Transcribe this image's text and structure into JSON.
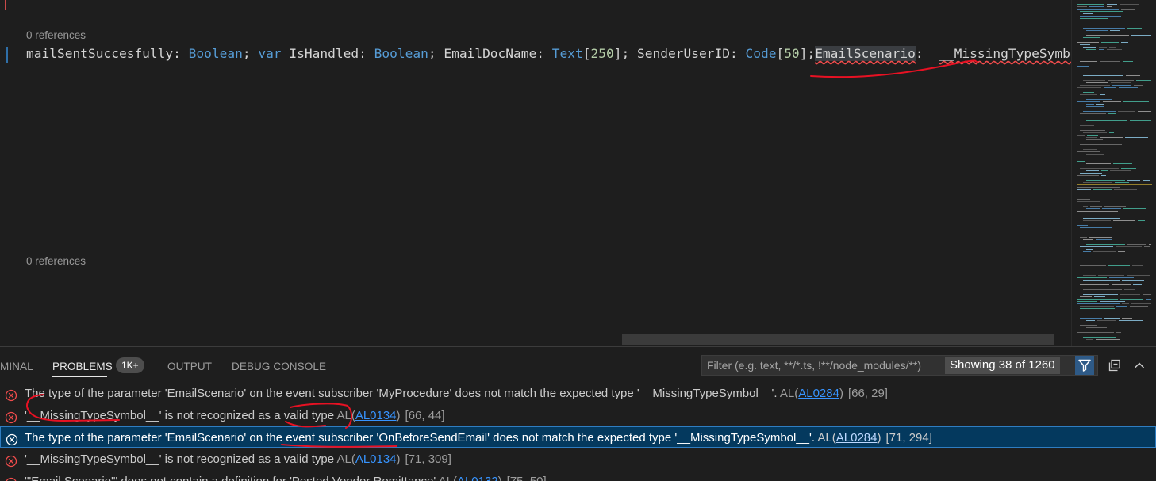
{
  "editor": {
    "codelens_top": "0 references",
    "codelens_bottom": "0 references",
    "code_segments": [
      {
        "text": "mailSentSuccesfully: ",
        "cls": ""
      },
      {
        "text": "Boolean",
        "cls": "tk-kw"
      },
      {
        "text": "; ",
        "cls": ""
      },
      {
        "text": "var",
        "cls": "tk-kw"
      },
      {
        "text": " IsHandled: ",
        "cls": ""
      },
      {
        "text": "Boolean",
        "cls": "tk-kw"
      },
      {
        "text": "; EmailDocName: ",
        "cls": ""
      },
      {
        "text": "Text",
        "cls": "tk-kw"
      },
      {
        "text": "[",
        "cls": ""
      },
      {
        "text": "250",
        "cls": "tk-num"
      },
      {
        "text": "]; SenderUserID: ",
        "cls": ""
      },
      {
        "text": "Code",
        "cls": "tk-kw"
      },
      {
        "text": "[",
        "cls": ""
      },
      {
        "text": "50",
        "cls": "tk-num"
      },
      {
        "text": "];",
        "cls": ""
      },
      {
        "text": "EmailScenario",
        "cls": "tk-sel"
      },
      {
        "text": ":  ",
        "cls": ""
      },
      {
        "text": "__MissingTypeSymbol_",
        "cls": "tk-err"
      }
    ]
  },
  "panel": {
    "tabs": {
      "terminal": "MINAL",
      "problems": "PROBLEMS",
      "problems_badge": "1K+",
      "output": "OUTPUT",
      "debug_console": "DEBUG CONSOLE"
    },
    "filter": {
      "placeholder": "Filter (e.g. text, **/*.ts, !**/node_modules/**)",
      "count": "Showing 38 of 1260"
    },
    "problems": [
      {
        "message": "The type of the parameter 'EmailScenario' on the event subscriber 'MyProcedure' does not match the expected type '__MissingTypeSymbol__'.",
        "source": "AL",
        "code": "AL0284",
        "location": "[66, 29]",
        "selected": false
      },
      {
        "message": "'__MissingTypeSymbol__' is not recognized as a valid type",
        "source": "AL",
        "code": "AL0134",
        "location": "[66, 44]",
        "selected": false
      },
      {
        "message": "The type of the parameter 'EmailScenario' on the event subscriber 'OnBeforeSendEmail' does not match the expected type '__MissingTypeSymbol__'.",
        "source": "AL",
        "code": "AL0284",
        "location": "[71, 294]",
        "selected": true
      },
      {
        "message": "'__MissingTypeSymbol__' is not recognized as a valid type",
        "source": "AL",
        "code": "AL0134",
        "location": "[71, 309]",
        "selected": false
      },
      {
        "message": "'\"Email Scenario\"' does not contain a definition for 'Posted Vendor Remittance'",
        "source": "AL",
        "code": "AL0132",
        "location": "[75, 50]",
        "selected": false
      }
    ]
  },
  "colors": {
    "error": "#f14c4c",
    "selection_bg": "#04395e",
    "link": "#3794ff",
    "annotation": "#e81123"
  }
}
